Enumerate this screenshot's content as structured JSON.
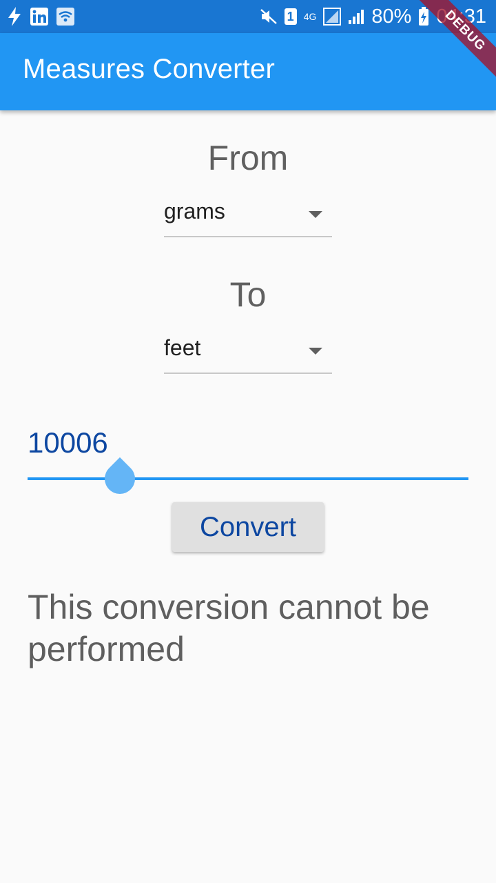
{
  "status_bar": {
    "left_icons": [
      "flash-icon",
      "linkedin-icon",
      "wifi-icon"
    ],
    "badge_number": "1",
    "network_type": "4G",
    "battery_percent": "80%",
    "time": "04:31"
  },
  "app_bar": {
    "title": "Measures Converter"
  },
  "debug_banner": {
    "label": "DEBUG"
  },
  "converter": {
    "from_label": "From",
    "from_value": "grams",
    "to_label": "To",
    "to_value": "feet",
    "input_value": "10006",
    "convert_button_label": "Convert",
    "result_text": "This conversion cannot be performed"
  },
  "colors": {
    "status_bar": "#1976d2",
    "app_bar": "#2196f3",
    "accent": "#0d47a1",
    "background": "#fafafa",
    "button": "#e0e0e0"
  }
}
